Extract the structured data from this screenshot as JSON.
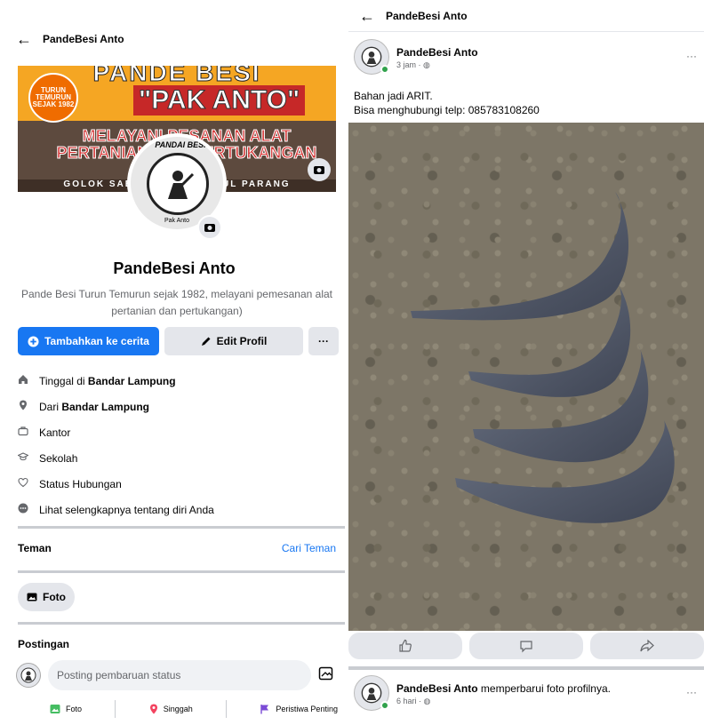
{
  "left": {
    "header": {
      "back_icon": "arrow-left-icon",
      "title": "PandeBesi Anto"
    },
    "cover": {
      "top_text": "PANDE BESI",
      "main_text": "\"PAK ANTO\"",
      "badge_text": "TURUN TEMURUN SEJAK 1982",
      "red_text": "MELAYANI PESANAN ALAT PERTANIAN DAN PERTUKANGAN",
      "bottom_text": "GOLOK SABIT ARIT CANGKUL PARANG",
      "camera_icon": "camera-icon"
    },
    "avatar": {
      "arc_text": "PANDAI BESI",
      "name_text": "Pak Anto",
      "camera_icon": "camera-icon"
    },
    "profile": {
      "name": "PandeBesi Anto",
      "bio": "Pande Besi Turun Temurun sejak 1982, melayani pemesanan alat pertanian dan pertukangan)"
    },
    "actions": {
      "story": "Tambahkan ke cerita",
      "edit": "Edit Profil",
      "more": "···"
    },
    "info": [
      {
        "icon": "home-icon",
        "prefix": "Tinggal di ",
        "value": "Bandar Lampung"
      },
      {
        "icon": "location-pin-icon",
        "prefix": "Dari ",
        "value": "Bandar Lampung"
      },
      {
        "icon": "briefcase-icon",
        "prefix": "Kantor",
        "value": ""
      },
      {
        "icon": "graduation-cap-icon",
        "prefix": "Sekolah",
        "value": ""
      },
      {
        "icon": "relationship-icon",
        "prefix": "Status Hubungan",
        "value": ""
      },
      {
        "icon": "more-circle-icon",
        "prefix": "Lihat selengkapnya tentang diri Anda",
        "value": ""
      }
    ],
    "friends": {
      "title": "Teman",
      "find": "Cari Teman"
    },
    "photos_chip": "Foto",
    "posts": {
      "title": "Postingan",
      "placeholder": "Posting pembaruan status"
    },
    "post_actions": {
      "photo": "Foto",
      "checkin": "Singgah",
      "event": "Peristiwa Penting"
    }
  },
  "right": {
    "header": {
      "back_icon": "arrow-left-icon",
      "title": "PandeBesi Anto"
    },
    "post": {
      "author": "PandeBesi Anto",
      "time": "3 jam · ",
      "text_line1": "Bahan jadi ARIT.",
      "text_line2": "Bisa menghubungi telp: 085783108260",
      "more": "···"
    },
    "reactions": {
      "like_icon": "thumbs-up-icon",
      "comment_icon": "comment-icon",
      "share_icon": "share-icon"
    },
    "post2": {
      "author": "PandeBesi Anto",
      "action": " memperbarui foto profilnya.",
      "time": "6 hari · ",
      "more": "···"
    }
  },
  "colors": {
    "accent": "#1877f2",
    "online": "#31a24c",
    "divider": "#c9ccd1",
    "soil": "#7d7667",
    "blade": "#4a5260"
  }
}
